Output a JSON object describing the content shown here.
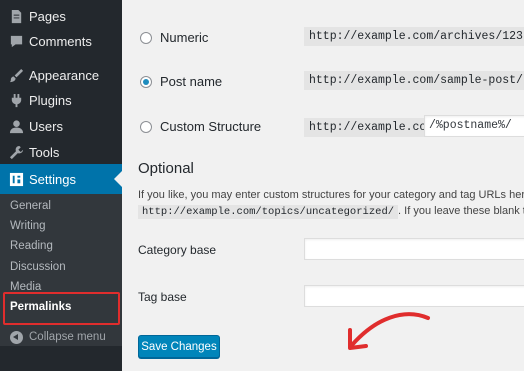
{
  "sidebar": {
    "items": [
      {
        "label": "Pages",
        "icon": "pages-icon"
      },
      {
        "label": "Comments",
        "icon": "comments-icon"
      },
      {
        "label": "Appearance",
        "icon": "appearance-icon"
      },
      {
        "label": "Plugins",
        "icon": "plugins-icon"
      },
      {
        "label": "Users",
        "icon": "users-icon"
      },
      {
        "label": "Tools",
        "icon": "tools-icon"
      },
      {
        "label": "Settings",
        "icon": "settings-icon",
        "active": true
      }
    ],
    "submenu": [
      {
        "label": "General"
      },
      {
        "label": "Writing"
      },
      {
        "label": "Reading"
      },
      {
        "label": "Discussion"
      },
      {
        "label": "Media"
      },
      {
        "label": "Permalinks",
        "current": true
      }
    ],
    "collapse_label": "Collapse menu"
  },
  "permalinks": {
    "options": [
      {
        "label": "Numeric",
        "example": "http://example.com/archives/123",
        "checked": false
      },
      {
        "label": "Post name",
        "example": "http://example.com/sample-post/",
        "checked": true
      },
      {
        "label": "Custom Structure",
        "prefix": "http://example.com",
        "value": "/%postname%/",
        "checked": false
      }
    ]
  },
  "optional": {
    "heading": "Optional",
    "description_1": "If you like, you may enter custom structures for your category and tag URLs here. Fo",
    "description_code": "http://example.com/topics/uncategorized/",
    "description_2": ". If you leave these blank the d",
    "category_base_label": "Category base",
    "category_base_value": "",
    "tag_base_label": "Tag base",
    "tag_base_value": ""
  },
  "actions": {
    "save_label": "Save Changes"
  },
  "colors": {
    "sidebar_bg": "#23282d",
    "submenu_bg": "#32373c",
    "accent": "#0073aa",
    "button": "#0085ba",
    "annotation_red": "#e02d2d"
  }
}
